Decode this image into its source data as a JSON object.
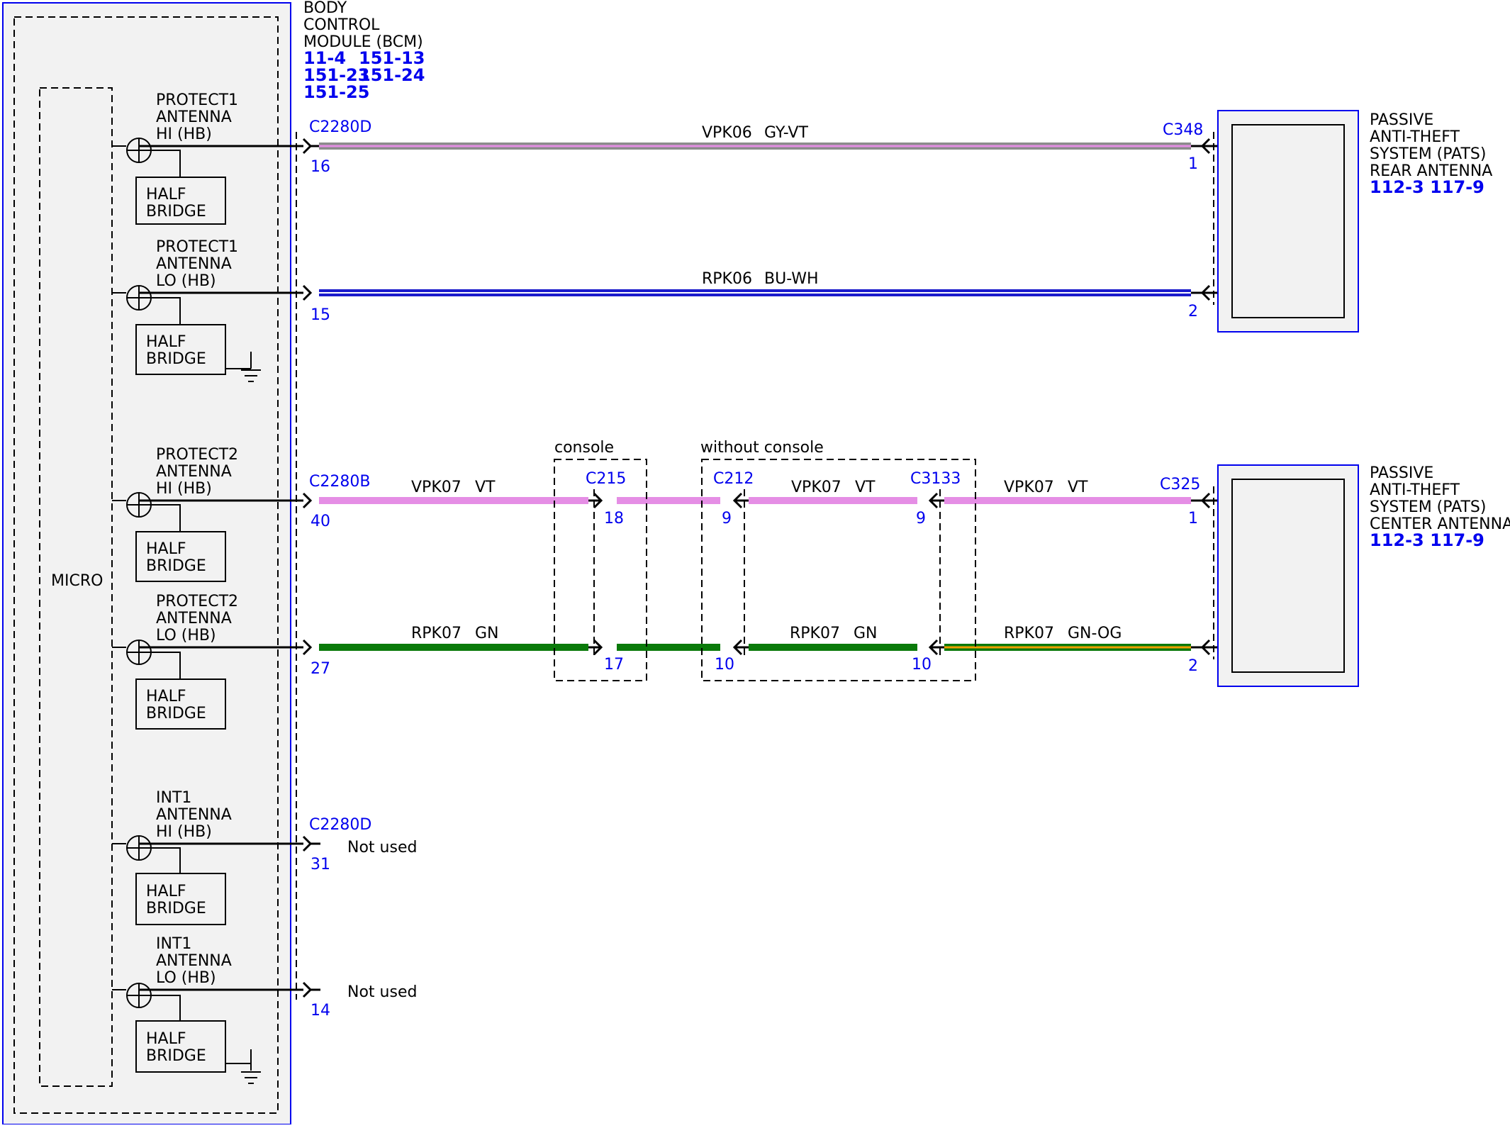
{
  "colors": {
    "module_border": "#0000ee",
    "module_fill": "#f2f2f2",
    "connector_text": "#0000ee",
    "ref_text": "#0000ee",
    "wire_vt": "#e58ee5",
    "wire_gy": "#8c8c8c",
    "wire_bu": "#1a1acc",
    "wire_gn": "#0a7a0a",
    "wire_og": "#f0a000"
  },
  "bcm": {
    "title_lines": [
      "BODY",
      "CONTROL",
      "MODULE (BCM)"
    ],
    "refs": [
      "11-4",
      "151-13",
      "151-23",
      "151-24",
      "151-25"
    ],
    "micro_label": "MICRO",
    "half_bridge_lines": [
      "HALF",
      "BRIDGE"
    ],
    "outputs": [
      {
        "label_lines": [
          "PROTECT1",
          "ANTENNA",
          "HI (HB)"
        ],
        "connector": "C2280D",
        "pin": "16"
      },
      {
        "label_lines": [
          "PROTECT1",
          "ANTENNA",
          "LO (HB)"
        ],
        "connector": "",
        "pin": "15"
      },
      {
        "label_lines": [
          "PROTECT2",
          "ANTENNA",
          "HI (HB)"
        ],
        "connector": "C2280B",
        "pin": "40"
      },
      {
        "label_lines": [
          "PROTECT2",
          "ANTENNA",
          "LO (HB)"
        ],
        "connector": "",
        "pin": "27"
      },
      {
        "label_lines": [
          "INT1",
          "ANTENNA",
          "HI (HB)"
        ],
        "connector": "C2280D",
        "pin": "31",
        "note": "Not used"
      },
      {
        "label_lines": [
          "INT1",
          "ANTENNA",
          "LO (HB)"
        ],
        "connector": "",
        "pin": "14",
        "note": "Not used"
      }
    ]
  },
  "rear_antenna": {
    "label_lines": [
      "PASSIVE",
      "ANTI-THEFT",
      "SYSTEM (PATS)",
      "REAR ANTENNA"
    ],
    "refs": "112-3 117-9",
    "connector": "C348",
    "pins": [
      "1",
      "2"
    ]
  },
  "center_antenna": {
    "label_lines": [
      "PASSIVE",
      "ANTI-THEFT",
      "SYSTEM (PATS)",
      "CENTER ANTENNA"
    ],
    "refs": "112-3 117-9",
    "connector": "C325",
    "pins": [
      "1",
      "2"
    ]
  },
  "wires": {
    "w1": {
      "circuit": "VPK06",
      "color": "GY-VT"
    },
    "w2": {
      "circuit": "RPK06",
      "color": "BU-WH"
    },
    "w3a": {
      "circuit": "VPK07",
      "color": "VT"
    },
    "w3b": {
      "circuit": "VPK07",
      "color": "VT"
    },
    "w3c": {
      "circuit": "VPK07",
      "color": "VT"
    },
    "w4a": {
      "circuit": "RPK07",
      "color": "GN"
    },
    "w4b": {
      "circuit": "RPK07",
      "color": "GN"
    },
    "w4c": {
      "circuit": "RPK07",
      "color": "GN-OG"
    }
  },
  "options": {
    "console": "console",
    "without_console": "without console"
  },
  "inline_connectors": {
    "c215": {
      "name": "C215",
      "pins": [
        "18",
        "17"
      ]
    },
    "c212": {
      "name": "C212",
      "pins": [
        "9",
        "10"
      ]
    },
    "c3133": {
      "name": "C3133",
      "pins": [
        "9",
        "10"
      ]
    }
  }
}
